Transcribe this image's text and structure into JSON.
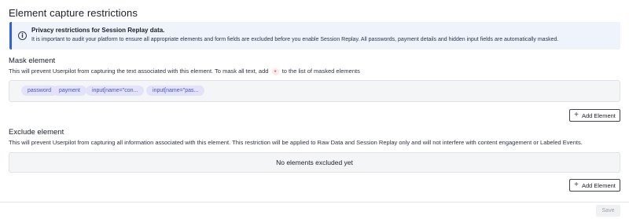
{
  "section": {
    "title": "Element capture restrictions"
  },
  "info": {
    "icon": "info-icon",
    "title": "Privacy restrictions for Session Replay data.",
    "text": "It is important to audit your platform to ensure all appropriate elements and form fields are excluded before you enable Session Replay. All passwords, payment details and hidden input fields are automatically masked."
  },
  "mask": {
    "title": "Mask element",
    "desc_before": "This will prevent Userpilot from capturing the text associated with this element. To mask all text, add",
    "asterisk": "*",
    "desc_after": "to the list of masked elements",
    "chips": [
      "password",
      "payment",
      "input[name=\"con...",
      "input[name=\"pas..."
    ],
    "add_label": "Add Element"
  },
  "exclude": {
    "title": "Exclude element",
    "desc": "This will prevent Userpilot from capturing all information associated with this element. This restriction will be applied to Raw Data and Session Replay only and will not interfere with content engagement or Labeled Events.",
    "empty": "No elements excluded yet",
    "add_label": "Add Element"
  },
  "footer": {
    "save_label": "Save"
  }
}
